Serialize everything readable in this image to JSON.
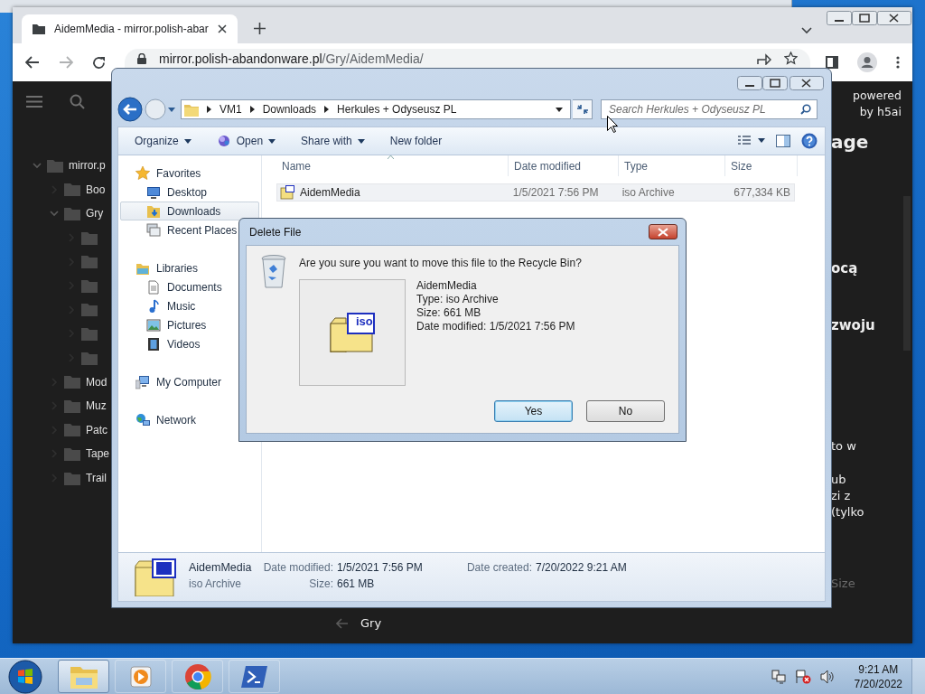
{
  "browser": {
    "tab": {
      "title": "AidemMedia - mirror.polish-abar"
    },
    "forward_enabled": false,
    "url": {
      "host": "mirror.polish-abandonware.pl",
      "path": "/Gry/AidemMedia/"
    }
  },
  "page": {
    "powered_by": [
      "powered",
      "by h5ai"
    ],
    "tree": [
      {
        "label": "mirror.p",
        "expanded": true,
        "selected": false,
        "children": [
          {
            "label": "Boo",
            "expanded": false,
            "selected": false
          },
          {
            "label": "Gry",
            "expanded": true,
            "selected": false,
            "children": [
              {
                "expanded": false
              },
              {
                "expanded": false
              },
              {
                "expanded": false
              },
              {
                "expanded": false
              },
              {
                "expanded": false
              },
              {
                "expanded": false
              }
            ]
          },
          {
            "label": "Mod",
            "expanded": false,
            "selected": false
          },
          {
            "label": "Muz",
            "expanded": false,
            "selected": false
          },
          {
            "label": "Patc",
            "expanded": false,
            "selected": false
          },
          {
            "label": "Tape",
            "expanded": false,
            "selected": false
          },
          {
            "label": "Trail",
            "expanded": false,
            "selected": false
          }
        ]
      }
    ],
    "fragments": [
      {
        "kind": "title",
        "text": "age"
      },
      {
        "kind": "heading",
        "text": "ocą"
      },
      {
        "kind": "heading",
        "text": "zwoju"
      },
      {
        "kind": "text",
        "text": "to w"
      },
      {
        "kind": "text",
        "text": "ub"
      },
      {
        "kind": "text",
        "text": "zi z"
      },
      {
        "kind": "text",
        "text": "(tylko"
      },
      {
        "kind": "column",
        "text": "Size"
      }
    ],
    "footer_crumb": "Gry"
  },
  "explorer": {
    "breadcrumb": [
      "VM1",
      "Downloads",
      "Herkules + Odyseusz PL"
    ],
    "search": {
      "placeholder": "Search Herkules + Odyseusz PL"
    },
    "toolbar": [
      {
        "label": "Organize",
        "dropdown": true
      },
      {
        "label": "Open",
        "dropdown": true
      },
      {
        "label": "Share with",
        "dropdown": true
      },
      {
        "label": "New folder",
        "dropdown": false
      }
    ],
    "nav": [
      {
        "kind": "group",
        "label": "Favorites",
        "selected": false
      },
      {
        "kind": "item",
        "label": "Desktop",
        "selected": false
      },
      {
        "kind": "item",
        "label": "Downloads",
        "selected": true
      },
      {
        "kind": "item",
        "label": "Recent Places",
        "selected": false
      },
      {
        "kind": "group",
        "label": "Libraries",
        "selected": false
      },
      {
        "kind": "item",
        "label": "Documents",
        "selected": false
      },
      {
        "kind": "item",
        "label": "Music",
        "selected": false
      },
      {
        "kind": "item",
        "label": "Pictures",
        "selected": false
      },
      {
        "kind": "item",
        "label": "Videos",
        "selected": false
      },
      {
        "kind": "group",
        "label": "My Computer",
        "selected": false
      },
      {
        "kind": "group",
        "label": "Network",
        "selected": false
      }
    ],
    "columns": [
      "Name",
      "Date modified",
      "Type",
      "Size"
    ],
    "rows": [
      {
        "selected": true,
        "cells": [
          "AidemMedia",
          "1/5/2021 7:56 PM",
          "iso Archive",
          "677,334 KB"
        ]
      }
    ],
    "details": {
      "name": "AidemMedia",
      "type": "iso Archive",
      "fields": [
        {
          "label": "Date modified:",
          "value": "1/5/2021 7:56 PM"
        },
        {
          "label": "Size:",
          "value": "661 MB"
        },
        {
          "label": "Date created:",
          "value": "7/20/2022 9:21 AM"
        }
      ]
    }
  },
  "dialog": {
    "title": "Delete File",
    "message": "Are you sure you want to move this file to the Recycle Bin?",
    "icon_label": "iso",
    "lines": [
      "AidemMedia",
      "Type: iso Archive",
      "Size: 661 MB",
      "Date modified: 1/5/2021 7:56 PM"
    ],
    "buttons": [
      {
        "label": "Yes",
        "selected": true
      },
      {
        "label": "No",
        "selected": false
      }
    ]
  },
  "taskbar": {
    "apps": [
      {
        "kind": "folder",
        "active": true
      },
      {
        "kind": "media",
        "active": false
      },
      {
        "kind": "browser",
        "active": false
      },
      {
        "kind": "terminal",
        "active": false
      }
    ],
    "time": "9:21 AM",
    "date": "7/20/2022"
  }
}
